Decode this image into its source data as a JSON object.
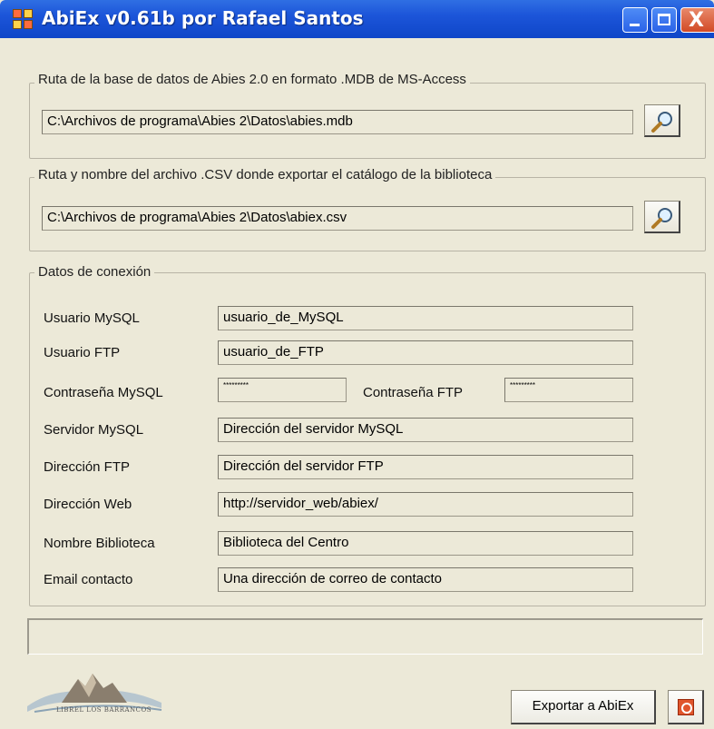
{
  "window": {
    "title": "AbiEx v0.61b por Rafael Santos",
    "close_glyph": "X"
  },
  "mdb_group": {
    "legend": "Ruta de la base de datos de Abies 2.0 en formato .MDB de MS-Access",
    "path": "C:\\Archivos de programa\\Abies 2\\Datos\\abies.mdb",
    "browse_icon": "magnifier-icon"
  },
  "csv_group": {
    "legend": "Ruta y nombre del archivo .CSV donde exportar el catálogo de la biblioteca",
    "path": "C:\\Archivos de programa\\Abies 2\\Datos\\abiex.csv",
    "browse_icon": "magnifier-icon"
  },
  "connection": {
    "legend": "Datos de conexión",
    "mysql_user_label": "Usuario MySQL",
    "mysql_user": "usuario_de_MySQL",
    "ftp_user_label": "Usuario FTP",
    "ftp_user": "usuario_de_FTP",
    "mysql_password_label": "Contraseña MySQL",
    "mysql_password": "*********",
    "ftp_password_label": "Contraseña FTP",
    "ftp_password": "*********",
    "mysql_server_label": "Servidor MySQL",
    "mysql_server": "Dirección del servidor MySQL",
    "ftp_address_label": "Dirección FTP",
    "ftp_address": "Dirección del servidor FTP",
    "web_address_label": "Dirección Web",
    "web_address": "http://servidor_web/abiex/",
    "library_name_label": "Nombre Biblioteca",
    "library_name": "Biblioteca del  Centro",
    "email_label": "Email contacto",
    "email": "Una dirección de correo de contacto"
  },
  "footer": {
    "export_button": "Exportar a AbiEx",
    "power_icon": "power-icon",
    "logo_caption": "LIBREL LOS BARRANCOS"
  },
  "colors": {
    "titlebar": "#0f46c8",
    "window_bg": "#ece9d8",
    "close_button": "#d24a26"
  }
}
